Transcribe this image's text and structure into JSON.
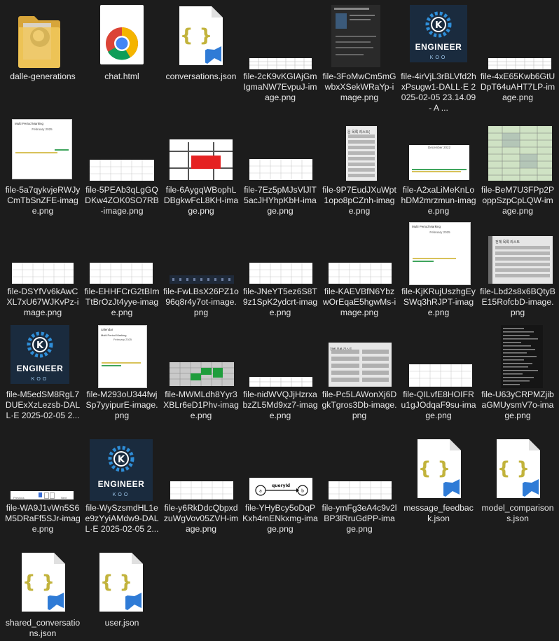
{
  "files": [
    {
      "id": "f01",
      "label": "dalle-generations",
      "kind": "folder"
    },
    {
      "id": "f02",
      "label": "chat.html",
      "kind": "chrome-html"
    },
    {
      "id": "f03",
      "label": "conversations.json",
      "kind": "json"
    },
    {
      "id": "f04",
      "label": "file-2cK9vKGIAjGmIgmaNW7EvpuJ-image.png",
      "kind": "image"
    },
    {
      "id": "f05",
      "label": "file-3FoMwCm5mGwbxXSekWRaYp-image.png",
      "kind": "image"
    },
    {
      "id": "f06",
      "label": "file-4irVjL3rBLVfd2hxPsugw1-DALL·E 2025-02-05 23.14.09 - A ...",
      "kind": "image"
    },
    {
      "id": "f07",
      "label": "file-4xE65Kwb6GtUDpT64uAHT7LP-image.png",
      "kind": "image"
    },
    {
      "id": "f08",
      "label": "file-5a7qykvjeRWJyCmTbSnZFE-image.png",
      "kind": "image"
    },
    {
      "id": "f09",
      "label": "file-5PEAb3qLgGQDKw4ZOK0SO7RB-image.png",
      "kind": "image"
    },
    {
      "id": "f10",
      "label": "file-6AygqWBophLDBgkwFcL8KH-image.png",
      "kind": "image"
    },
    {
      "id": "f11",
      "label": "file-7Ez5pMJsVlJlT5acJHYhpKbH-image.png",
      "kind": "image"
    },
    {
      "id": "f12",
      "label": "file-9P7EudJXuWpt1opo8pCZnh-image.png",
      "kind": "image"
    },
    {
      "id": "f13",
      "label": "file-A2xaLiMeKnLohDM2mrzmun-image.png",
      "kind": "image"
    },
    {
      "id": "f14",
      "label": "file-BeM7U3FPp2PoppSzpCpLQW-image.png",
      "kind": "image"
    },
    {
      "id": "f15",
      "label": "file-DSYfVv6kAwCXL7xU67WJKvPz-image.png",
      "kind": "image"
    },
    {
      "id": "f16",
      "label": "file-EHHFCrG2tBImTtBrOzJt4yye-image.png",
      "kind": "image"
    },
    {
      "id": "f17",
      "label": "file-FwLBsX26PZ1o96q8r4y7ot-image.png",
      "kind": "image"
    },
    {
      "id": "f18",
      "label": "file-JNeYT5ez6S8T9z1SpK2ydcrt-image.png",
      "kind": "image"
    },
    {
      "id": "f19",
      "label": "file-KAEVBfN6YbzwOrEqaE5hgwMs-image.png",
      "kind": "image"
    },
    {
      "id": "f20",
      "label": "file-KjKRujUszhgEySWq3hRJPT-image.png",
      "kind": "image"
    },
    {
      "id": "f21",
      "label": "file-Lbd2s8x6BQtyBE15RofcbD-image.png",
      "kind": "image"
    },
    {
      "id": "f22",
      "label": "file-M5edSM8RgL7DUExXzLezsb-DALL·E 2025-02-05 2...",
      "kind": "image"
    },
    {
      "id": "f23",
      "label": "file-M293oU344fwjSp7yyipurE-image.png",
      "kind": "image"
    },
    {
      "id": "f24",
      "label": "file-MWMLdh8Yyr3XBLr6eD1Phv-image.png",
      "kind": "image"
    },
    {
      "id": "f25",
      "label": "file-nidWVQJjHzrxabzZL5Md9xz7-image.png",
      "kind": "image"
    },
    {
      "id": "f26",
      "label": "file-Pc5LAWonXj6DgkTgros3Db-image.png",
      "kind": "image"
    },
    {
      "id": "f27",
      "label": "file-QILvfE8HOIFRu1gJOdqaF9su-image.png",
      "kind": "image"
    },
    {
      "id": "f28",
      "label": "file-U63yCRPMZjibaGMUysmV7o-image.png",
      "kind": "image"
    },
    {
      "id": "f29",
      "label": "file-WA9J1vWn5S6M5DRaFf5SJr-image.png",
      "kind": "image"
    },
    {
      "id": "f30",
      "label": "file-WySzsmdHL1ee9zYyiAMdw9-DALL·E 2025-02-05 2...",
      "kind": "image"
    },
    {
      "id": "f31",
      "label": "file-y6RkDdcQbpxdzuWgVov05ZVH-image.png",
      "kind": "image"
    },
    {
      "id": "f32",
      "label": "file-YHyBcy5oDqPKxh4mENkxmg-image.png",
      "kind": "image"
    },
    {
      "id": "f33",
      "label": "file-ymFg3eA4c9v2lBP3lRruGdPP-image.png",
      "kind": "image"
    },
    {
      "id": "f34",
      "label": "message_feedback.json",
      "kind": "json"
    },
    {
      "id": "f35",
      "label": "model_comparisons.json",
      "kind": "json"
    },
    {
      "id": "f36",
      "label": "shared_conversations.json",
      "kind": "json"
    },
    {
      "id": "f37",
      "label": "user.json",
      "kind": "json"
    }
  ],
  "thumb_text": {
    "logo_top": "ENGINEER",
    "logo_bottom": "KOO",
    "logo_letter": "K",
    "calendar_title": "Multi Period Marking",
    "calendar_month": "February 2025",
    "calendar_month_alt": "December 2022",
    "calendar_header": "calendar",
    "edge_label": "queryId",
    "node_a": "a",
    "node_b": "b",
    "pager_prev": "Previous",
    "pager_next": "Next",
    "list_title": "문 목록 리스트(",
    "list_title_alt": "전체 목록 리스트"
  },
  "colors": {
    "background": "#1c1c1c",
    "text": "#e8e8e8",
    "folder": "#e9c46a",
    "json_braces": "#c2b33c",
    "vscode_blue": "#2f7bd6",
    "logo_bg": "#1a2b3e",
    "logo_accent": "#2f8ed8",
    "highlight_red": "#e52222",
    "green": "#1f9d3c"
  }
}
